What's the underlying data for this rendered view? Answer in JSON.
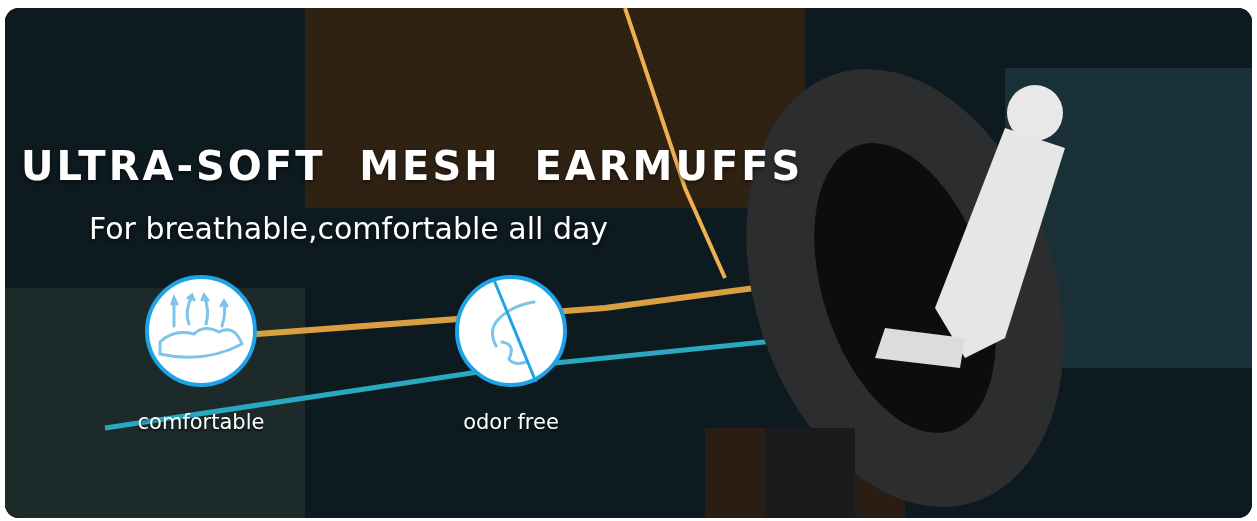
{
  "banner": {
    "title": "ULTRA-SOFT  MESH  EARMUFFS",
    "subtitle": "For breathable,comfortable all day",
    "features": [
      {
        "kind": "breathable",
        "label": "comfortable"
      },
      {
        "kind": "odor",
        "label": "odor free"
      }
    ]
  }
}
